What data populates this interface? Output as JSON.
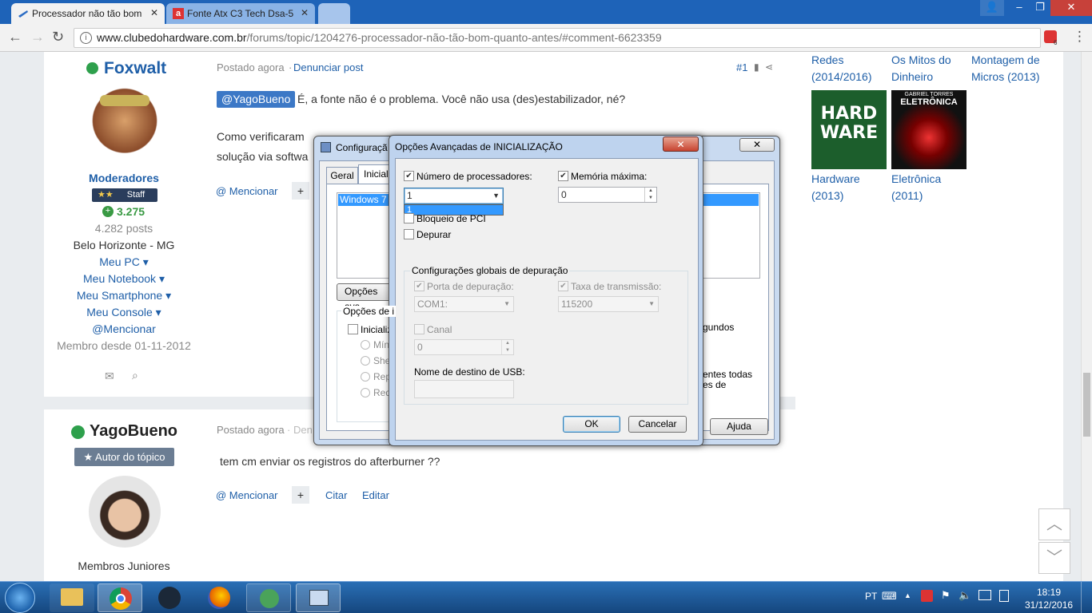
{
  "browser": {
    "tabs": [
      {
        "label": "Processador não tão bom"
      },
      {
        "label": "Fonte Atx C3 Tech Dsa-5"
      },
      {
        "label": ""
      }
    ],
    "url_domain": "www.clubedohardware.com.br",
    "url_path": "/forums/topic/1204276-processador-não-tão-bom-quanto-antes/#comment-6623359",
    "ext_badge": "6"
  },
  "post1": {
    "author": "Foxwalt",
    "group": "Moderadores",
    "badge": "Staff",
    "reputation": "3.275",
    "posts": "4.282 posts",
    "location": "Belo Horizonte - MG",
    "links": [
      "Meu PC",
      "Meu Notebook",
      "Meu Smartphone",
      "Meu Console"
    ],
    "mention_user": "@Mencionar",
    "member_since": "Membro desde 01-11-2012",
    "posted": "Postado agora",
    "report": "Denunciar post",
    "number": "#1",
    "quote_tag": "@YagoBueno",
    "text1": "É, a fonte não é o problema. Você não usa (des)estabilizador, né?",
    "text2": "Como verificaram",
    "text2b": "solução via softwa",
    "mention": "@ Mencionar"
  },
  "post2": {
    "author": "YagoBueno",
    "badge": "Autor do tópico",
    "group": "Membros Juniores",
    "posted": "Postado agora",
    "report_partial": "Den",
    "text": "tem cm enviar os registros do afterburner ??",
    "mention": "@ Mencionar",
    "quote": "Citar",
    "edit": "Editar"
  },
  "sidebar": {
    "books": [
      {
        "title": "Redes (2014/2016)"
      },
      {
        "title": "Os Mitos do Dinheiro"
      },
      {
        "title": "Montagem de Micros (2013)"
      },
      {
        "title": "Hardware (2013)"
      },
      {
        "title": "Eletrônica (2011)"
      }
    ],
    "cover1_text": "HARD WARE",
    "cover2_top": "GABRIEL TORRES",
    "cover2_text": "ELETRÔNICA"
  },
  "msconfig": {
    "title": "Configuraçã",
    "tabs": [
      "Geral",
      "Iniciali"
    ],
    "os_entry": "Windows 7 (",
    "advanced_btn": "Opções ava",
    "boot_options": "Opções de i",
    "safe_boot": "Inicializ",
    "radio_labels": [
      "Míni",
      "She",
      "Rep",
      "Red"
    ],
    "right_text1": "gundos",
    "right_text2": "entes todas",
    "right_text3": "es de",
    "help_btn": "Ajuda"
  },
  "advanced": {
    "title": "Opções Avançadas de INICIALIZAÇÃO",
    "num_proc_label": "Número de processadores:",
    "num_proc_value": "1",
    "dropdown_option": "1",
    "max_mem_label": "Memória máxima:",
    "max_mem_value": "0",
    "pci_lock": "Bloqueio de PCI",
    "debug": "Depurar",
    "global_debug": "Configurações globais de depuração",
    "debug_port_label": "Porta de depuração:",
    "debug_port_value": "COM1:",
    "baud_label": "Taxa de transmissão:",
    "baud_value": "115200",
    "channel_label": "Canal",
    "channel_value": "0",
    "usb_label": "Nome de destino de USB:",
    "ok": "OK",
    "cancel": "Cancelar"
  },
  "taskbar": {
    "lang": "PT",
    "time": "18:19",
    "date": "31/12/2016"
  }
}
